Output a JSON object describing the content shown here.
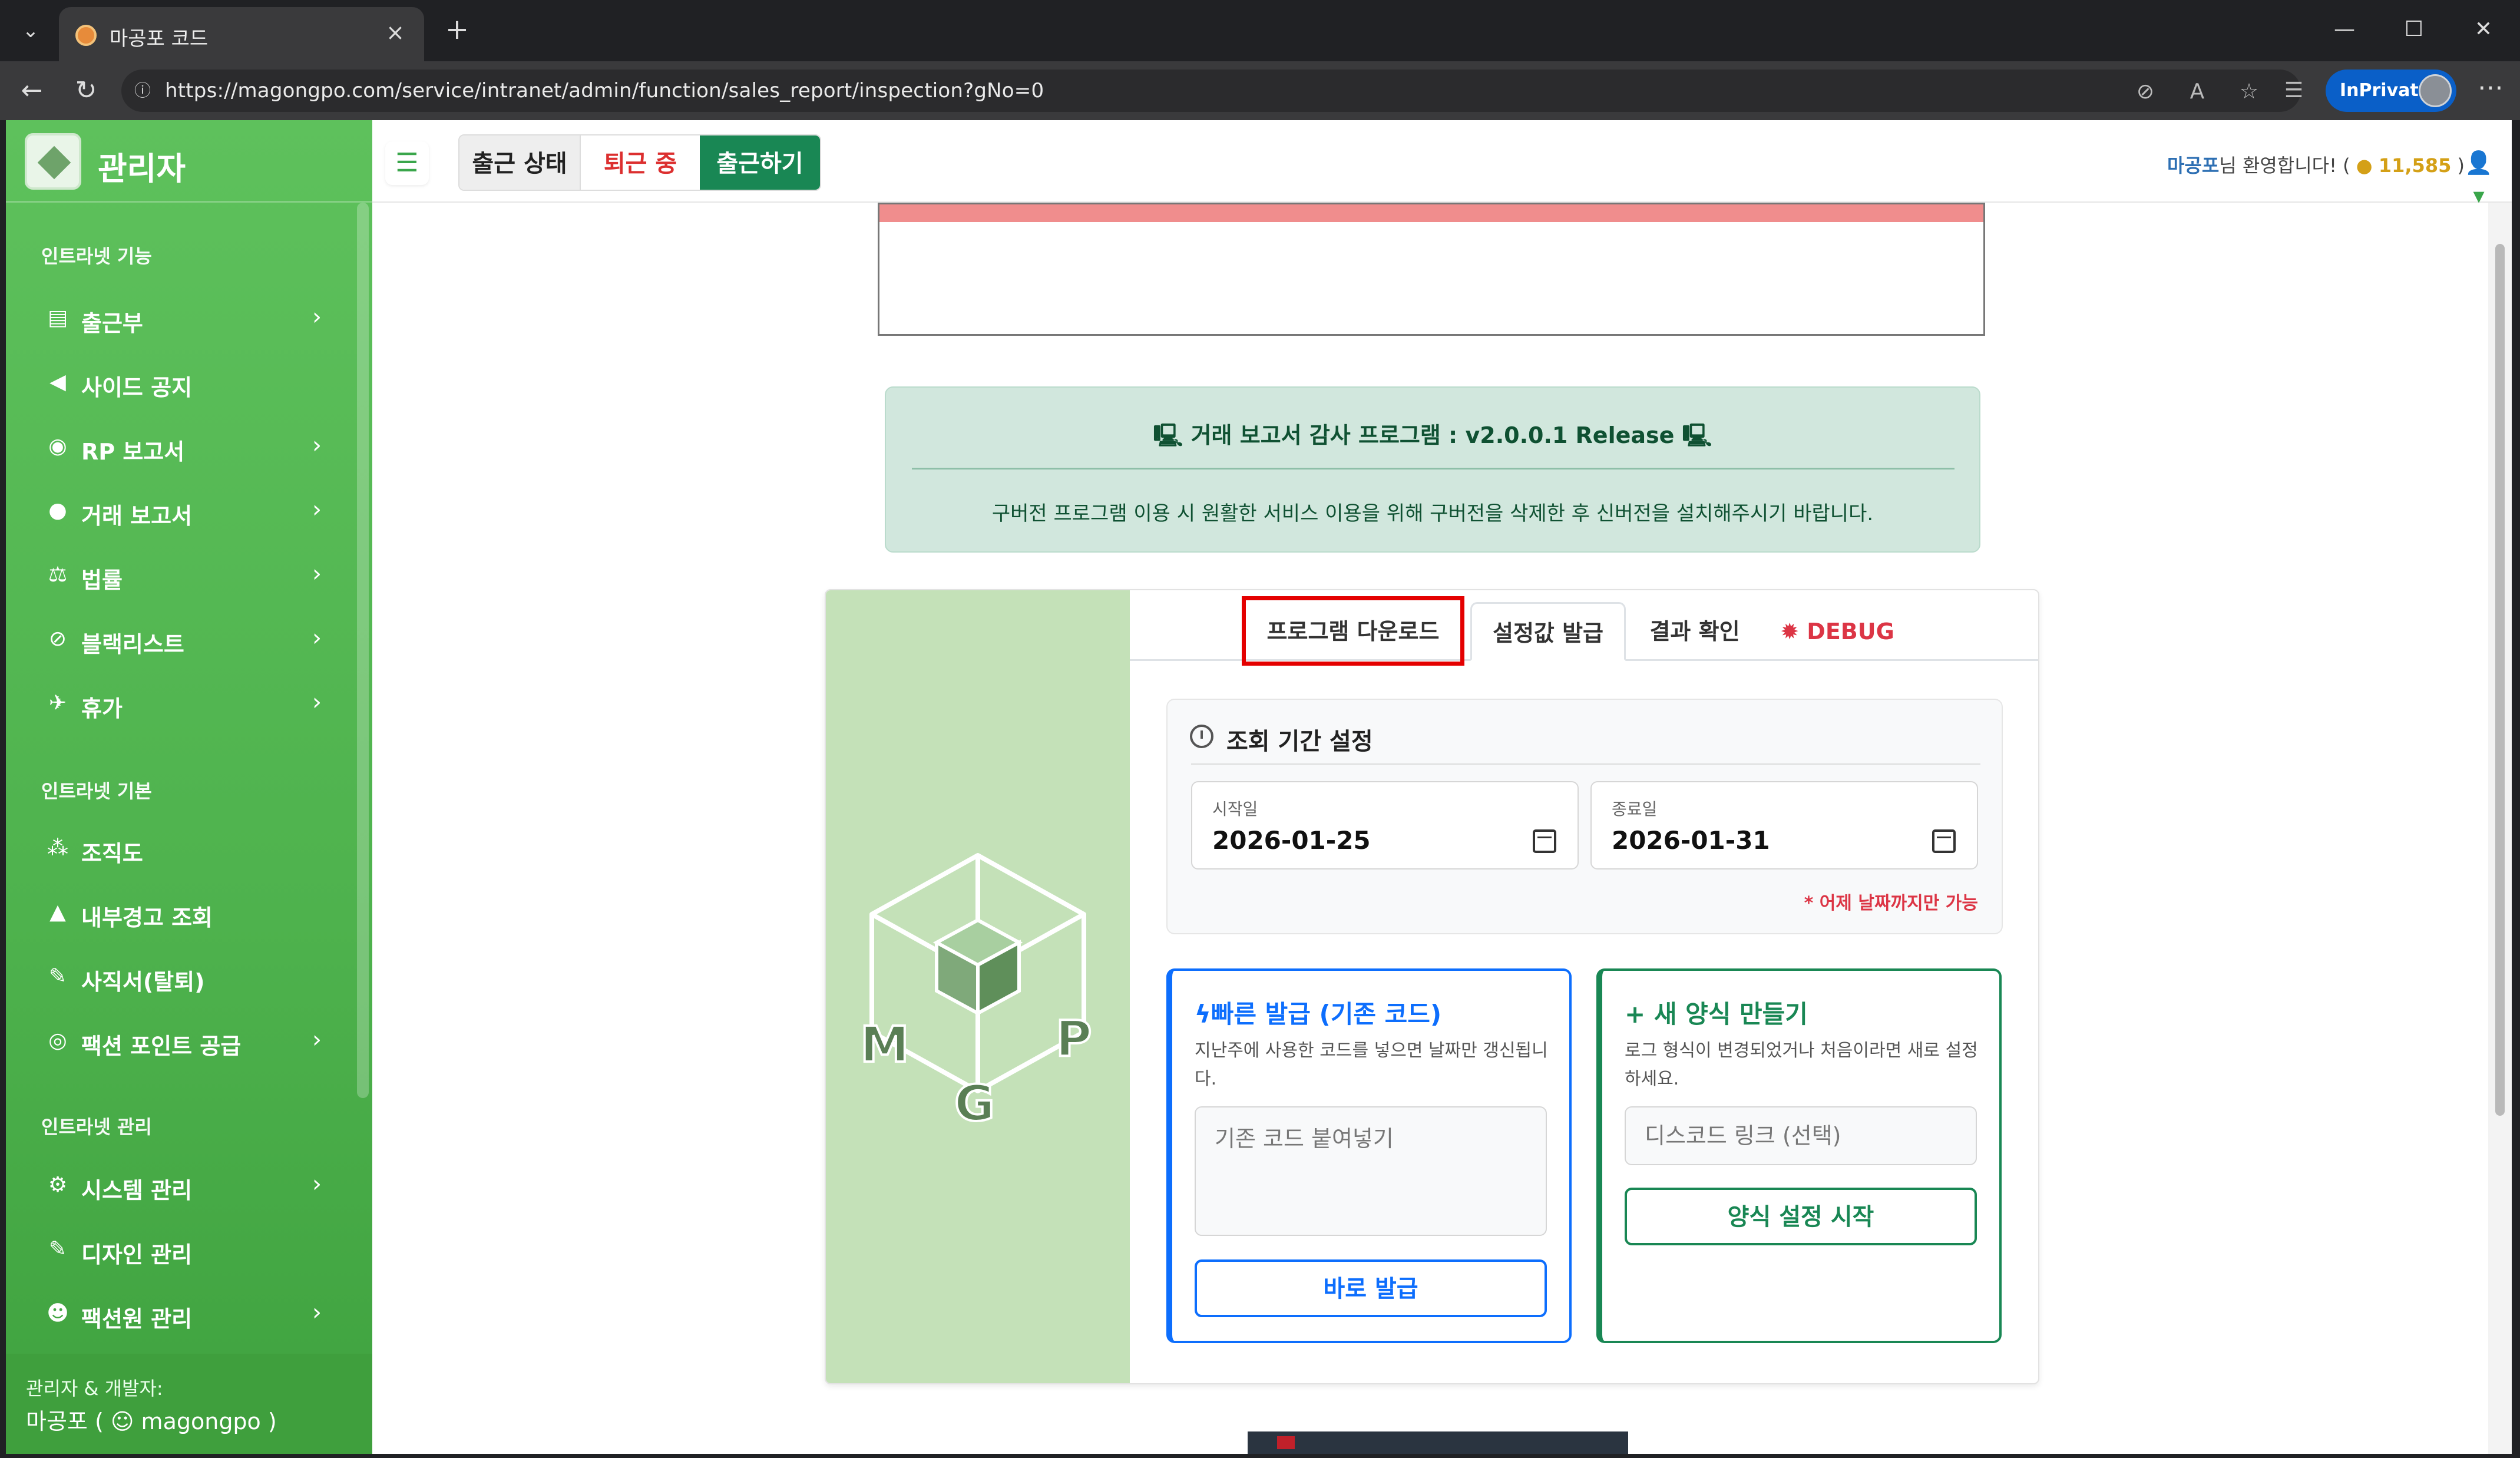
{
  "browser": {
    "tab_title": "마공포 코드",
    "url": "https://magongpo.com/service/intranet/admin/function/sales_report/inspection?gNo=0",
    "inprivate_label": "InPrivate"
  },
  "sidebar": {
    "brand": "관리자",
    "sections": [
      {
        "title": "인트라넷 기능",
        "items": [
          {
            "label": "출근부",
            "icon": "book-icon",
            "has_children": true
          },
          {
            "label": "사이드 공지",
            "icon": "megaphone-icon",
            "has_children": false
          },
          {
            "label": "RP 보고서",
            "icon": "gamepad-icon",
            "has_children": true
          },
          {
            "label": "거래 보고서",
            "icon": "money-bag-icon",
            "has_children": true
          },
          {
            "label": "법률",
            "icon": "scale-icon",
            "has_children": true
          },
          {
            "label": "블랙리스트",
            "icon": "ban-icon",
            "has_children": true
          },
          {
            "label": "휴가",
            "icon": "plane-icon",
            "has_children": true
          }
        ]
      },
      {
        "title": "인트라넷 기본",
        "items": [
          {
            "label": "조직도",
            "icon": "sitemap-icon",
            "has_children": false
          },
          {
            "label": "내부경고 조회",
            "icon": "warning-icon",
            "has_children": false
          },
          {
            "label": "사직서(탈퇴)",
            "icon": "feather-icon",
            "has_children": false
          },
          {
            "label": "팩션 포인트 공급",
            "icon": "coins-icon",
            "has_children": true
          }
        ]
      },
      {
        "title": "인트라넷 관리",
        "items": [
          {
            "label": "시스템 관리",
            "icon": "gear-icon",
            "has_children": true
          },
          {
            "label": "디자인 관리",
            "icon": "brush-icon",
            "has_children": false
          },
          {
            "label": "팩션원 관리",
            "icon": "user-gear-icon",
            "has_children": true
          }
        ]
      }
    ],
    "footer_line1": "관리자 & 개발자:",
    "footer_line2": "마공포 ( ☺ magongpo )"
  },
  "topbar": {
    "attendance_label": "출근 상태",
    "attendance_status": "퇴근 중",
    "checkin_button": "출근하기",
    "welcome_user": "마공포",
    "welcome_text": "님 환영합니다! (",
    "points": "11,585",
    "welcome_close": " )"
  },
  "notice": {
    "title": "거래 보고서 감사 프로그램 : v2.0.0.1 Release",
    "message": "구버전 프로그램 이용 시 원활한 서비스 이용을 위해 구버전을 삭제한 후 신버전을 설치해주시기 바랍니다."
  },
  "tabs": [
    {
      "label": "프로그램 다운로드",
      "active": false
    },
    {
      "label": "설정값 발급",
      "active": true
    },
    {
      "label": "결과 확인",
      "active": false
    },
    {
      "label": "DEBUG",
      "active": false
    }
  ],
  "period": {
    "title": "조회 기간 설정",
    "start_label": "시작일",
    "start_value": "2026-01-25",
    "end_label": "종료일",
    "end_value": "2026-01-31",
    "note": "* 어제 날짜까지만 가능"
  },
  "quick_issue": {
    "title": "빠른 발급 (기존 코드)",
    "desc": "지난주에 사용한 코드를 넣으면 날짜만 갱신됩니다.",
    "placeholder": "기존 코드 붙여넣기",
    "button": "바로 발급"
  },
  "new_form": {
    "title": "새 양식 만들기",
    "desc": "로그 형식이 변경되었거나 처음이라면 새로 설정하세요.",
    "placeholder": "디스코드 링크 (선택)",
    "button": "양식 설정 시작"
  },
  "logo_letters": [
    "M",
    "G",
    "P"
  ],
  "colors": {
    "sidebar_green": "#4eb24d",
    "primary_blue": "#0d6efd",
    "success_green": "#198754",
    "danger_red": "#dc3545",
    "highlight_red": "#e40000"
  }
}
